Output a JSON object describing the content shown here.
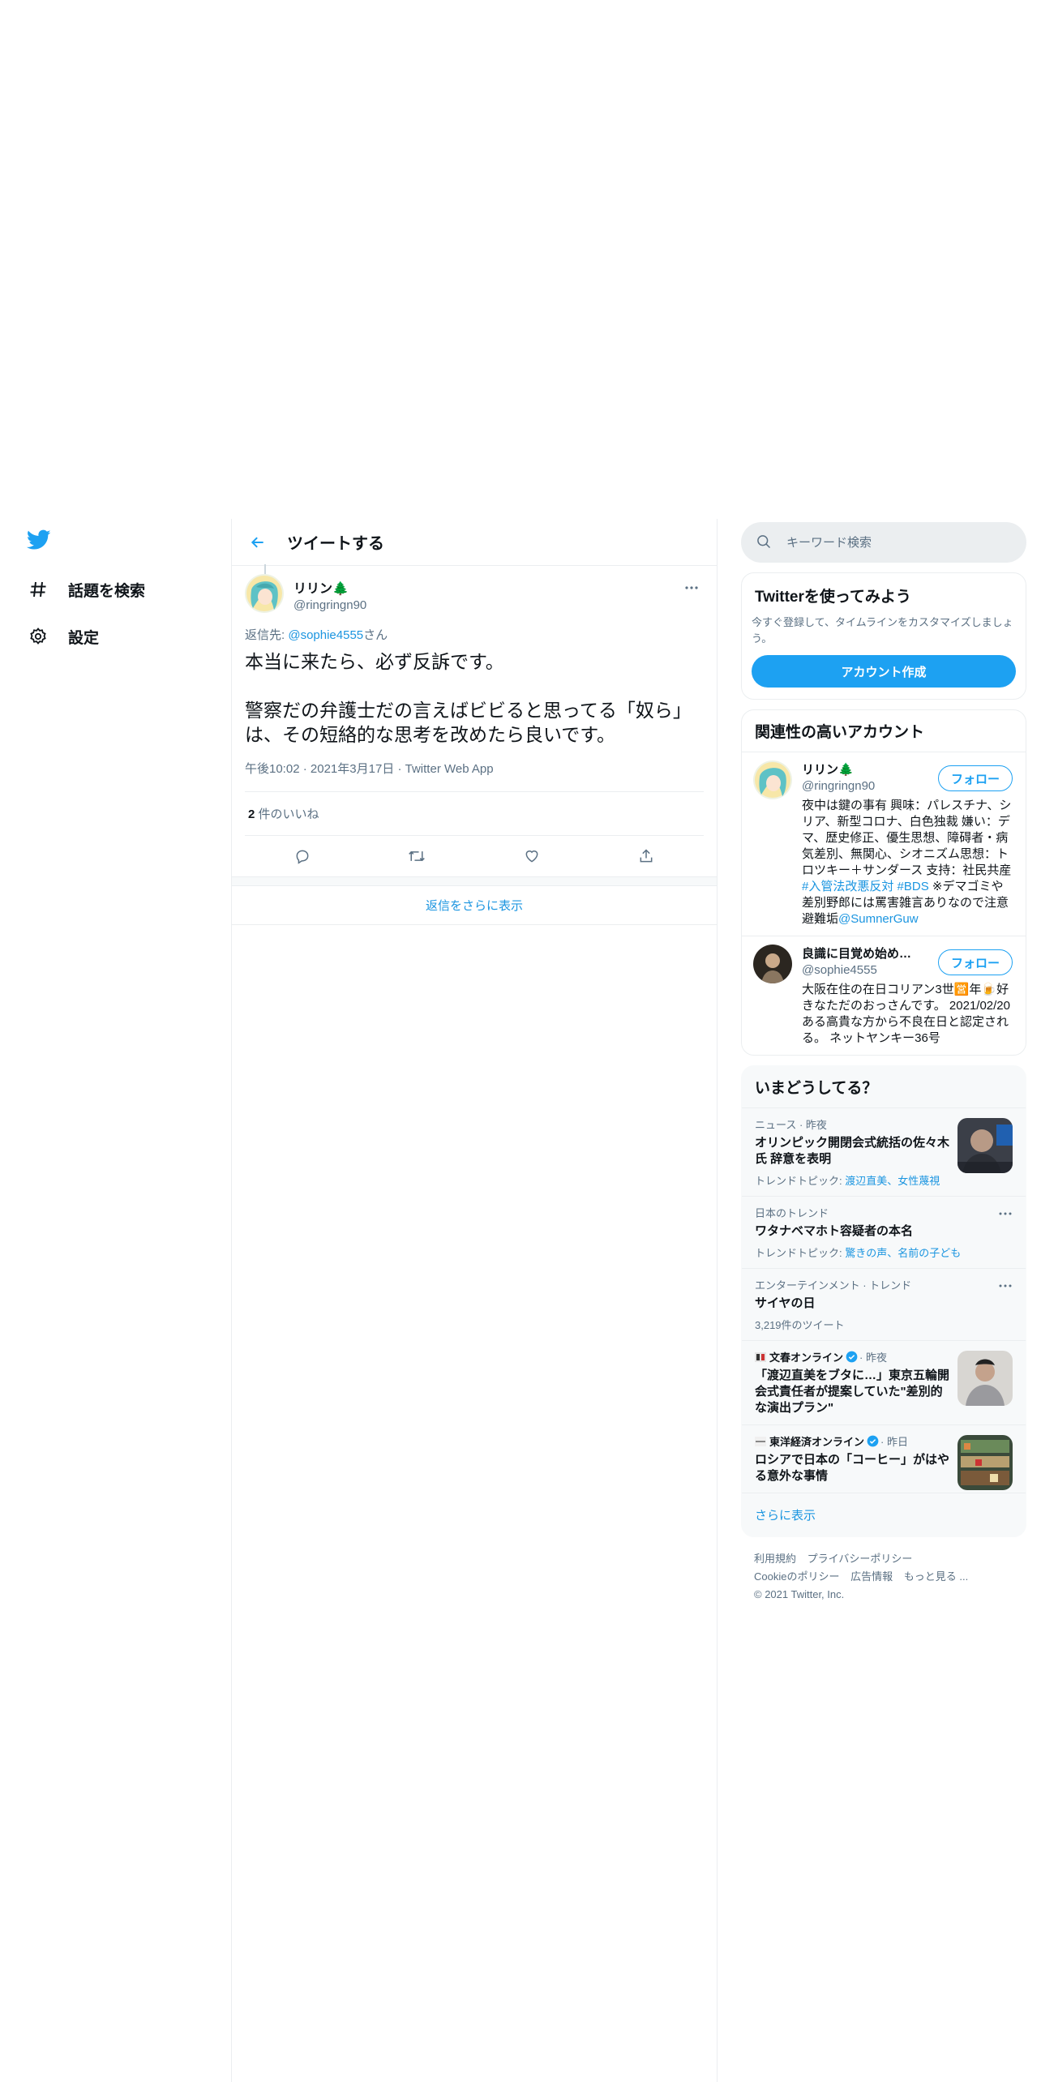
{
  "nav": {
    "items": [
      {
        "label": "話題を検索",
        "icon": "hashtag-icon"
      },
      {
        "label": "設定",
        "icon": "gear-icon"
      }
    ]
  },
  "header": {
    "title": "ツイートする"
  },
  "tweet": {
    "display_name": "リリン🌲",
    "handle": "@ringringn90",
    "reply_prefix": "返信先: ",
    "reply_handle": "@sophie4555",
    "reply_suffix": "さん",
    "text": "本当に来たら、必ず反訴です。\n\n警察だの弁護士だの言えばビビると思ってる「奴ら」は、その短絡的な思考を改めたら良いです。",
    "time": "午後10:02",
    "date": "2021年3月17日",
    "source": "Twitter Web App",
    "separator": "·",
    "likes_count": "2",
    "likes_label": " 件のいいね"
  },
  "show_more_replies": "返信をさらに表示",
  "search": {
    "placeholder": "キーワード検索"
  },
  "signup": {
    "title": "Twitterを使ってみよう",
    "description": "今すぐ登録して、タイムラインをカスタマイズしましょう。",
    "button": "アカウント作成"
  },
  "related": {
    "title": "関連性の高いアカウント",
    "follow_label": "フォロー",
    "accounts": [
      {
        "name": "リリン🌲",
        "handle": "@ringringn90",
        "bio_text": "夜中は鍵の事有 興味：パレスチナ、シリア、新型コロナ、白色独裁 嫌い：デマ、歴史修正、優生思想、障碍者・病気差別、無関心、シオニズム思想：トロツキー＋サンダース 支持：社民共産 ",
        "bio_links": [
          "#入管法改悪反対",
          "#BDS"
        ],
        "bio_text2": "※デマゴミや差別野郎には罵害雑言ありなので注意 避難垢",
        "bio_mention": "@SumnerGuw"
      },
      {
        "name": "良識に目覚め始めた(…",
        "handle": "@sophie4555",
        "bio_text": "大阪在住の在日コリアン3世🈺年🍺好きなただのおっさんです。 2021/02/20 ある高貴な方から不良在日と認定される。 ネットヤンキー36号"
      }
    ]
  },
  "trends": {
    "title": "いまどうしてる？",
    "items": [
      {
        "context": "ニュース · 昨夜",
        "name": "オリンピック開閉会式統括の佐々木氏 辞意を表明",
        "sub_prefix": "トレンドトピック: ",
        "sub_links": "渡辺直美、女性蔑視",
        "has_image": true
      },
      {
        "context": "日本のトレンド",
        "name": "ワタナベマホト容疑者の本名",
        "sub_prefix": "トレンドトピック: ",
        "sub_links": "驚きの声、名前の子ども",
        "has_more": true
      },
      {
        "context": "エンターテインメント · トレンド",
        "name": "サイヤの日",
        "sub_plain": "3,219件のツイート",
        "has_more": true
      },
      {
        "publisher": "文春オンライン",
        "publisher_time": "· 昨夜",
        "name": "「渡辺直美をブタに…」東京五輪開会式責任者が提案していた\"差別的な演出プラン\"",
        "has_image": true
      },
      {
        "publisher": "東洋経済オンライン",
        "publisher_time": "· 昨日",
        "name": "ロシアで日本の「コーヒー」がはやる意外な事情",
        "has_image": true
      }
    ],
    "show_more": "さらに表示"
  },
  "footer": {
    "links": [
      "利用規約",
      "プライバシーポリシー",
      "Cookieのポリシー",
      "広告情報",
      "もっと見る ..."
    ],
    "copyright": "© 2021 Twitter, Inc."
  },
  "colors": {
    "accent": "#1da1f2",
    "link": "#1b95e0",
    "muted": "#5b7083"
  }
}
